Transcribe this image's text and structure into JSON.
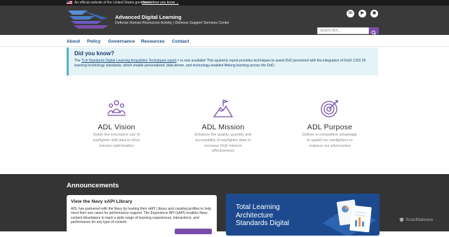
{
  "gov_banner": {
    "text": "An official website of the United States government",
    "link": "Here's how you know ⌄"
  },
  "header": {
    "title": "Advanced Digital Learning",
    "subtitle": "Defense Human Resources Activity | Defense Support Services Center",
    "social": [
      {
        "icon": "linkedin-icon",
        "glyph": "in"
      },
      {
        "icon": "youtube-icon",
        "glyph": "▶"
      },
      {
        "icon": "github-icon",
        "glyph": "◉"
      }
    ],
    "search_placeholder": "Search ADL..."
  },
  "nav": {
    "items": [
      "About",
      "Policy",
      "Governance",
      "Resources",
      "Contact"
    ]
  },
  "callout": {
    "title": "Did you know?",
    "prefix": "The ",
    "link": "TLA Standards Digital Learning Acquisition Techniques report",
    "suffix": " is now available! This quarterly report provides techniques to assist DoD personnel with the integration of DoDI 1322.26 learning technology standards, which enable personalized, data-driven, and technology-enabled lifelong learning across the DoD."
  },
  "features": [
    {
      "icon": "team-icon",
      "title": "ADL Vision",
      "desc": "Guide the innovative use of warfighter skill data to drive mission optimization"
    },
    {
      "icon": "mountain-flag-icon",
      "title": "ADL Mission",
      "desc": "Enhance the quality, quantity and accessibility of warfighter data to increase DoD mission effectiveness"
    },
    {
      "icon": "target-icon",
      "title": "ADL Purpose",
      "desc": "Deliver a competitive advantage to upskill our warfighters to outpace our adversaries"
    }
  ],
  "announcements": {
    "heading": "Announcements",
    "card": {
      "title": "View the Navy xAPI Library",
      "body": "ADL has partnered with the Navy by hosting their xAPI Library and creating profiles to help meet their use cases for performance support. The Experience API (xAPI) enables Navy content developers to track a wide range of learning experiences, interactions, and performance for any type of content."
    },
    "promo_text": "Total Learning Architecture Standards Digital"
  },
  "watermark": "ScanMalware",
  "colors": {
    "header_bg": "#3a3a3a",
    "accent_purple": "#7a4ea8",
    "nav_blue": "#1f4f86",
    "callout_bg": "#e3f3f7",
    "announce_bg": "#343434"
  }
}
